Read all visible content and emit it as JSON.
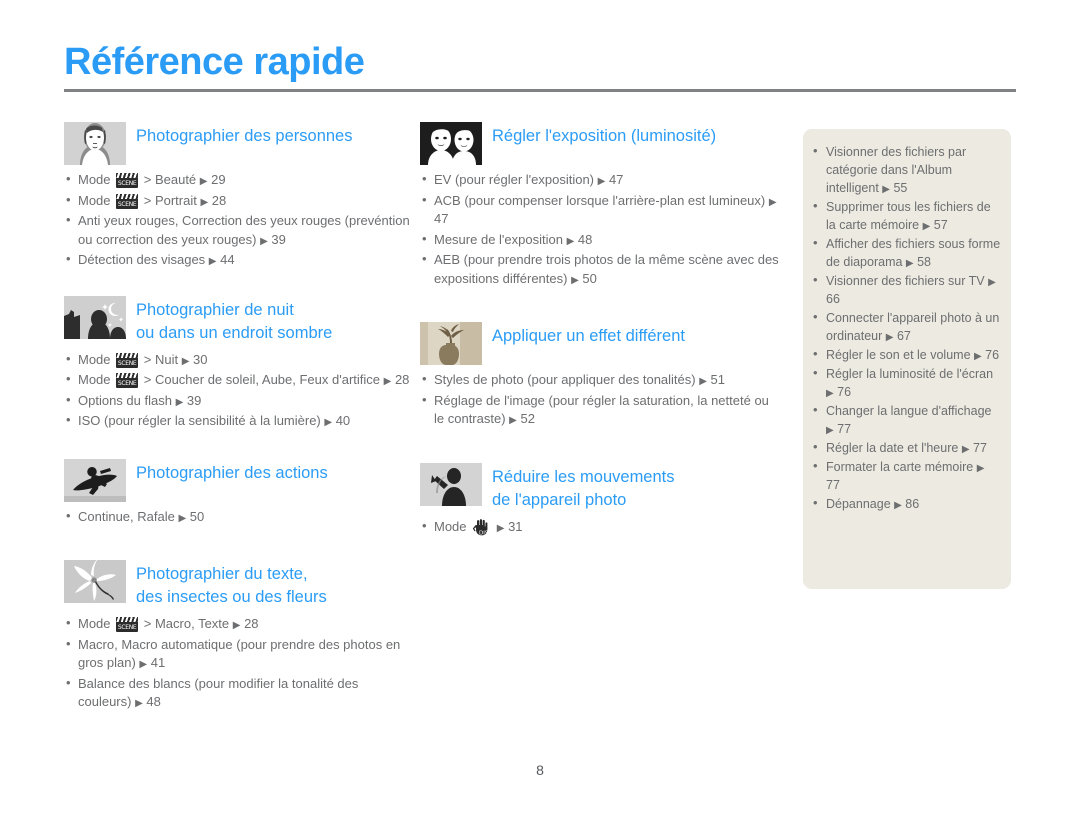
{
  "header": {
    "title": "Référence rapide",
    "title_color": "#2b9cf5",
    "rule_color": "#808285"
  },
  "footer": {
    "page_number": "8"
  },
  "icons": {
    "arrow": "▶",
    "bullet": "•",
    "scene_mode_label": "SCENE",
    "dis_mode_label": "DIS"
  },
  "columns": {
    "left": [
      {
        "id": "photographier-des-personnes",
        "thumb": "portrait-woman-thumbnail",
        "title_line1": "Photographier des personnes",
        "title_line2": "",
        "items": [
          {
            "pre": "Mode ",
            "icon": "scene",
            "post": " > Beauté ",
            "arrow": "▶",
            "page": "29"
          },
          {
            "pre": "Mode ",
            "icon": "scene",
            "post": " > Portrait ",
            "arrow": "▶",
            "page": "28"
          },
          {
            "text": "Anti yeux rouges, Correction des yeux rouges (prevéntion ou correction des yeux rouges) ",
            "arrow": "▶",
            "page": "39"
          },
          {
            "text": "Détection des visages ",
            "arrow": "▶",
            "page": "44"
          }
        ]
      },
      {
        "id": "photographier-de-nuit",
        "thumb": "night-scene-thumbnail",
        "title_line1": "Photographier de nuit",
        "title_line2": "ou dans un endroit sombre",
        "items": [
          {
            "pre": "Mode ",
            "icon": "scene",
            "post": " > Nuit ",
            "arrow": "▶",
            "page": "30"
          },
          {
            "pre": "Mode ",
            "icon": "scene",
            "post": " > Coucher de soleil, Aube, Feux d'artifice ",
            "arrow": "▶",
            "page": "28"
          },
          {
            "text": "Options du flash ",
            "arrow": "▶",
            "page": "39"
          },
          {
            "text": "ISO (pour régler la sensibilité à la lumière) ",
            "arrow": "▶",
            "page": "40"
          }
        ]
      },
      {
        "id": "photographier-des-actions",
        "thumb": "snowboarder-thumbnail",
        "title_line1": "Photographier des actions",
        "title_line2": "",
        "items": [
          {
            "text": "Continue, Rafale ",
            "arrow": "▶",
            "page": "50"
          }
        ]
      },
      {
        "id": "photographier-du-texte",
        "thumb": "flower-macro-thumbnail",
        "title_line1": "Photographier du texte,",
        "title_line2": "des insectes ou des fleurs",
        "items": [
          {
            "pre": "Mode ",
            "icon": "scene",
            "post": " > Macro, Texte ",
            "arrow": "▶",
            "page": "28"
          },
          {
            "text": "Macro, Macro automatique (pour prendre des photos en gros plan) ",
            "arrow": "▶",
            "page": "41"
          },
          {
            "text": "Balance des blancs (pour modifier la tonalité des couleurs) ",
            "arrow": "▶",
            "page": "48"
          }
        ]
      }
    ],
    "middle": [
      {
        "id": "regler-l-exposition",
        "thumb": "two-faces-thumbnail",
        "title_line1": "Régler l'exposition (luminosité)",
        "title_line2": "",
        "items": [
          {
            "text": "EV (pour régler l'exposition) ",
            "arrow": "▶",
            "page": "47"
          },
          {
            "text": "ACB (pour compenser lorsque l'arrière-plan est lumineux) ",
            "arrow": "▶",
            "page": "47"
          },
          {
            "text": "Mesure de l'exposition ",
            "arrow": "▶",
            "page": "48"
          },
          {
            "text": "AEB (pour prendre trois photos de la même scène avec des expositions différentes) ",
            "arrow": "▶",
            "page": "50"
          }
        ]
      },
      {
        "id": "appliquer-un-effet-different",
        "thumb": "sepia-vase-thumbnail",
        "title_line1": "Appliquer un effet différent",
        "title_line2": "",
        "items": [
          {
            "text": "Styles de photo (pour appliquer des tonalités) ",
            "arrow": "▶",
            "page": "51"
          },
          {
            "text": "Réglage de l'image (pour régler la saturation, la netteté ou le contraste) ",
            "arrow": "▶",
            "page": "52"
          }
        ]
      },
      {
        "id": "reduire-les-mouvements",
        "thumb": "shaking-person-thumbnail",
        "title_line1": "Réduire les mouvements",
        "title_line2": "de l'appareil photo",
        "items": [
          {
            "pre": "Mode ",
            "icon": "dis",
            "post": " ",
            "arrow": "▶",
            "page": "31"
          }
        ]
      }
    ]
  },
  "sidebar": {
    "background_color": "#edeae1",
    "items": [
      {
        "text": "Visionner des fichiers par catégorie dans l'Album intelligent ",
        "arrow": "▶",
        "page": "55"
      },
      {
        "text": "Supprimer tous les fichiers de la carte mémoire ",
        "arrow": "▶",
        "page": "57"
      },
      {
        "text": "Afficher des fichiers sous forme de diaporama ",
        "arrow": "▶",
        "page": "58"
      },
      {
        "text": "Visionner des fichiers sur TV ",
        "arrow": "▶",
        "page": "66"
      },
      {
        "text": "Connecter l'appareil photo à un ordinateur ",
        "arrow": "▶",
        "page": "67"
      },
      {
        "text": "Régler le son et le volume ",
        "arrow": "▶",
        "page": "76"
      },
      {
        "text": "Régler la luminosité de l'écran ",
        "arrow": "▶",
        "page": "76"
      },
      {
        "text": "Changer la langue d'affichage ",
        "arrow": "▶",
        "page": "77"
      },
      {
        "text": "Régler la date et l'heure ",
        "arrow": "▶",
        "page": "77"
      },
      {
        "text": "Formater la carte mémoire ",
        "arrow": "▶",
        "page": "77"
      },
      {
        "text": "Dépannage ",
        "arrow": "▶",
        "page": "86"
      }
    ]
  }
}
